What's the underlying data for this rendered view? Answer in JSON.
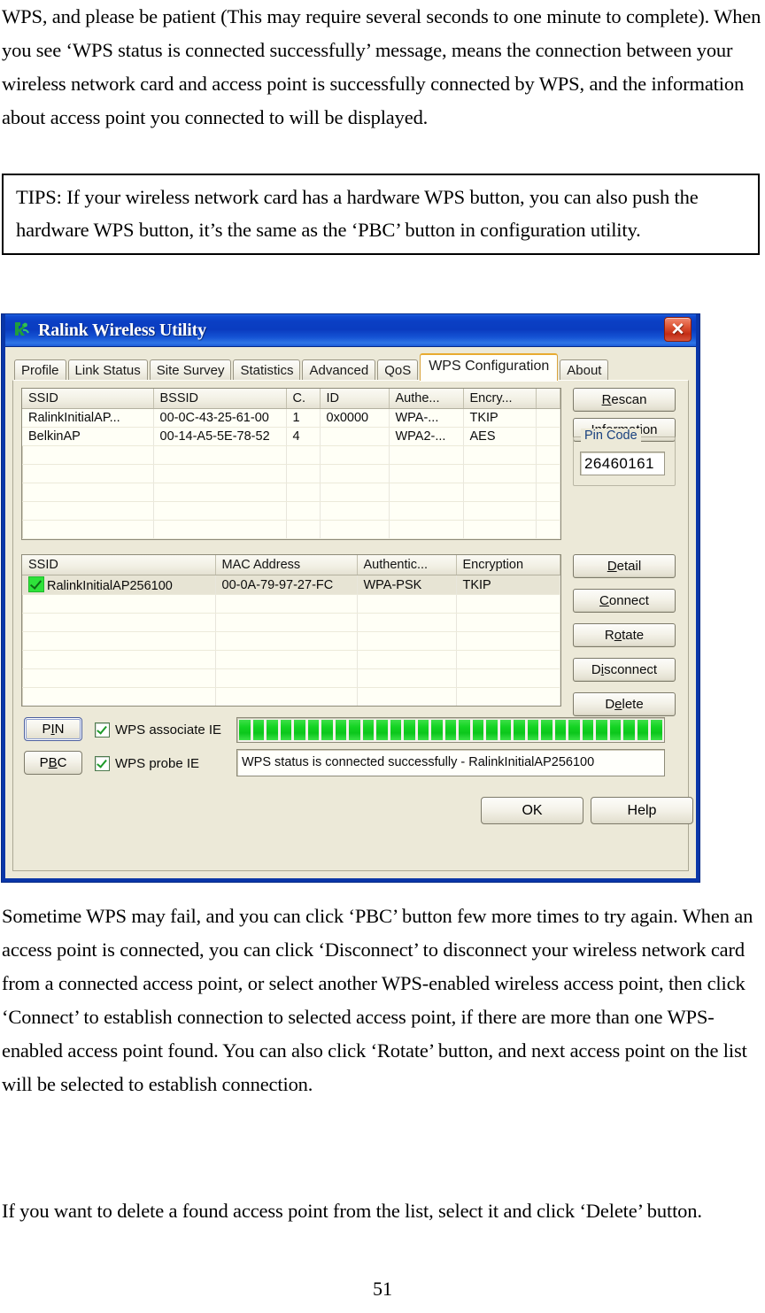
{
  "document": {
    "top_paragraph": "WPS, and please be patient (This may require several seconds to one minute to complete). When you see ‘WPS status is connected successfully’ message, means the connection between your wireless network card and access point is successfully connected by WPS, and the information about access point you connected to will be displayed.",
    "tips_box": "TIPS: If your wireless network card has a hardware WPS button, you can also push the hardware WPS button, it’s the same as the ‘PBC’ button in configuration utility.",
    "middle_paragraph": "Sometime WPS may fail, and you can click ‘PBC’ button few more times to try again. When an access point is connected, you can click ‘Disconnect’ to disconnect your wireless network card from a connected access point, or select another WPS-enabled wireless access point, then click ‘Connect’ to establish connection to selected access point, if there are more than one WPS-enabled access point found. You can also click ‘Rotate’ button, and next access point on the list will be selected to establish connection.",
    "bottom_paragraph": "If you want to delete a found access point from the list, select it and click ‘Delete’ button.",
    "page_number": "51"
  },
  "window": {
    "title": "Ralink Wireless Utility",
    "close_label": "✕",
    "titlebar_color": "#0a3cc0",
    "frame_color": "#0a36a8",
    "face_color": "#ece9d8"
  },
  "tabs": [
    {
      "label": "Profile",
      "active": false
    },
    {
      "label": "Link Status",
      "active": false
    },
    {
      "label": "Site Survey",
      "active": false
    },
    {
      "label": "Statistics",
      "active": false
    },
    {
      "label": "Advanced",
      "active": false
    },
    {
      "label": "QoS",
      "active": false
    },
    {
      "label": "WPS Configuration",
      "active": true
    },
    {
      "label": "About",
      "active": false
    }
  ],
  "ap_list": {
    "columns": [
      "SSID",
      "BSSID",
      "C.",
      "ID",
      "Authe...",
      "Encry...",
      ""
    ],
    "rows": [
      [
        "RalinkInitialAP...",
        "00-0C-43-25-61-00",
        "1",
        "0x0000",
        "WPA-...",
        "TKIP",
        ""
      ],
      [
        "BelkinAP",
        "00-14-A5-5E-78-52",
        "4",
        "",
        "WPA2-...",
        "AES",
        ""
      ]
    ],
    "empty_row_count": 5
  },
  "ap_buttons": [
    {
      "label": "Rescan",
      "accel": "R"
    },
    {
      "label": "Information",
      "accel": "I"
    }
  ],
  "pin_code": {
    "group_title": "Pin Code",
    "value": "26460161"
  },
  "profile_list": {
    "columns": [
      "SSID",
      "MAC Address",
      "Authentic...",
      "Encryption"
    ],
    "rows": [
      {
        "checked": true,
        "cells": [
          "RalinkInitialAP256100",
          "00-0A-79-97-27-FC",
          "WPA-PSK",
          "TKIP"
        ]
      }
    ],
    "empty_row_count": 5
  },
  "profile_buttons": [
    {
      "label": "Detail",
      "accel": "D"
    },
    {
      "label": "Connect",
      "accel": "C"
    },
    {
      "label": "Rotate",
      "accel": "o"
    },
    {
      "label": "Disconnect",
      "accel": "i"
    },
    {
      "label": "Delete",
      "accel": "e"
    }
  ],
  "wps_controls": {
    "pin_button": "PIN",
    "pbc_button": "PBC",
    "associate_ie_label": "WPS associate IE",
    "associate_ie_checked": true,
    "probe_ie_label": "WPS probe IE",
    "probe_ie_checked": true,
    "progress_percent": 100,
    "progress_segments": 31,
    "progress_color": "#14d423",
    "status_text": "WPS status is connected successfully - RalinkInitialAP256100"
  },
  "dialog_buttons": {
    "ok": "OK",
    "help": "Help"
  }
}
